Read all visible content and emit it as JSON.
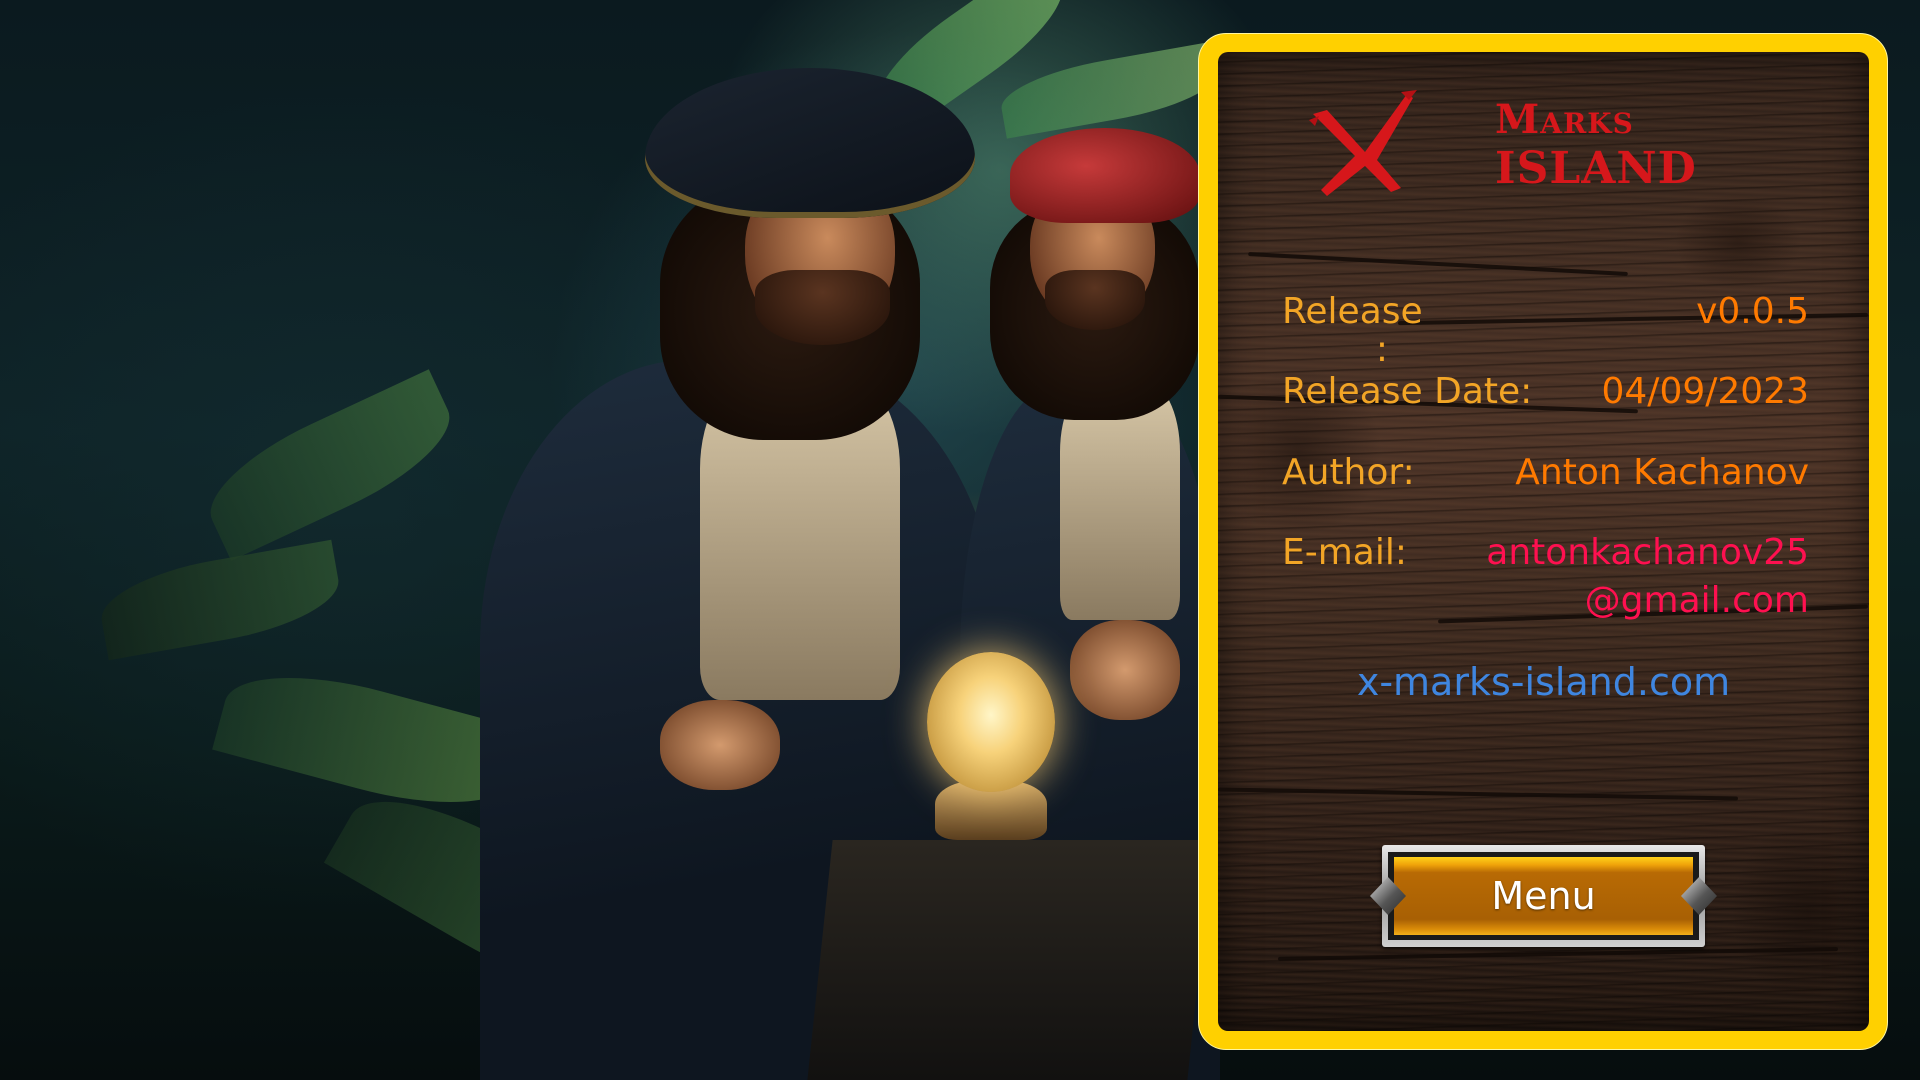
{
  "screen": "About",
  "logo": {
    "mark": "X",
    "line1": "Marks",
    "line2": "ISLAND",
    "color": "#d6171b"
  },
  "info": {
    "release": {
      "label": "Release",
      "label_wrap": ":",
      "value": "v0.0.5"
    },
    "release_date": {
      "label": "Release Date:",
      "value": "04/09/2023"
    },
    "author": {
      "label": "Author:",
      "value": "Anton Kachanov"
    },
    "email": {
      "label": "E-mail:",
      "value_line1": "antonkachanov25",
      "value_line2": "@gmail.com"
    }
  },
  "website": "x-marks-island.com",
  "menu_button": {
    "label": "Menu"
  },
  "colors": {
    "frame": "#ffd000",
    "label": "#f2a526",
    "value": "#ff7a00",
    "email": "#ff1050",
    "link": "#3f86e0"
  },
  "background": {
    "description": "pirates-in-jungle-illustration"
  }
}
